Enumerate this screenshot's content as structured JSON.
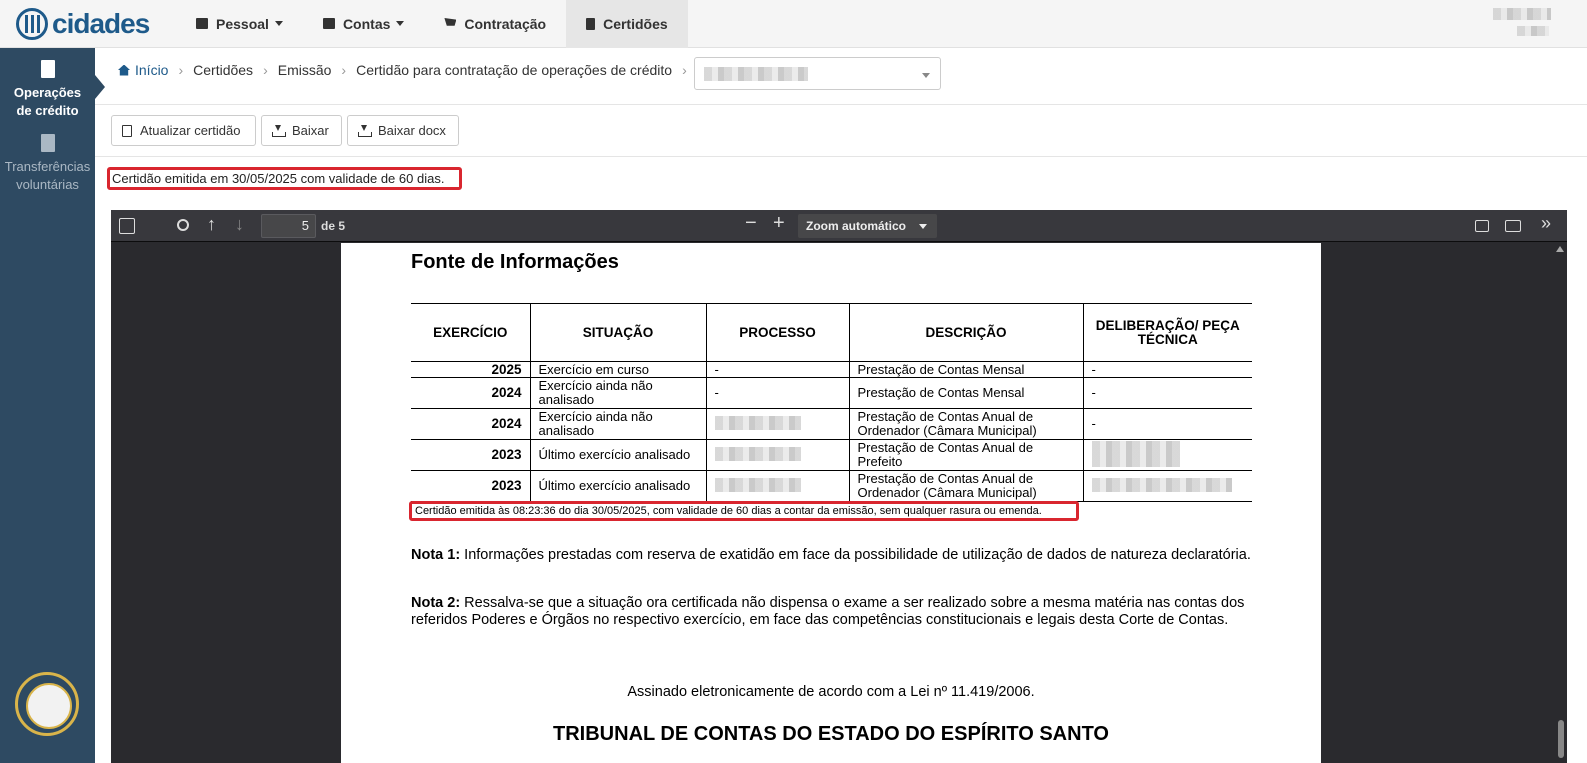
{
  "nav": {
    "logo": "cidades",
    "items": [
      {
        "label": "Pessoal"
      },
      {
        "label": "Contas"
      },
      {
        "label": "Contratação"
      },
      {
        "label": "Certidões"
      }
    ]
  },
  "sidebar": {
    "items": [
      {
        "label": "Operações de crédito"
      },
      {
        "label": "Transferências voluntárias"
      }
    ]
  },
  "breadcrumb": [
    "Início",
    "Certidões",
    "Emissão",
    "Certidão para contratação de operações de crédito"
  ],
  "toolbar": {
    "update": "Atualizar certidão",
    "download": "Baixar",
    "download_docx": "Baixar docx"
  },
  "issue_note": "Certidão emitida em 30/05/2025 com validade de 60 dias.",
  "pdf": {
    "page": "5",
    "of": "de 5",
    "zoom": "Zoom automático",
    "title": "Fonte de Informações",
    "headers": [
      "EXERCÍCIO",
      "SITUAÇÃO",
      "PROCESSO",
      "DESCRIÇÃO",
      "DELIBERAÇÃO/ PEÇA TÉCNICA"
    ],
    "rows": [
      {
        "ano": "2025",
        "situacao": "Exercício em curso",
        "processo": "-",
        "descricao": "Prestação de Contas Mensal",
        "deliberacao": "-"
      },
      {
        "ano": "2024",
        "situacao": "Exercício ainda não analisado",
        "processo": "-",
        "descricao": "Prestação de Contas Mensal",
        "deliberacao": "-"
      },
      {
        "ano": "2024",
        "situacao": "Exercício ainda não analisado",
        "processo": "",
        "descricao": "Prestação de Contas Anual de Ordenador (Câmara Municipal)",
        "deliberacao": "-"
      },
      {
        "ano": "2023",
        "situacao": "Último exercício analisado",
        "processo": "",
        "descricao": "Prestação de Contas Anual de Prefeito",
        "deliberacao": ""
      },
      {
        "ano": "2023",
        "situacao": "Último exercício analisado",
        "processo": "",
        "descricao": "Prestação de Contas Anual de Ordenador (Câmara Municipal)",
        "deliberacao": ""
      }
    ],
    "emit_note": "Certidão emitida às 08:23:36 do dia 30/05/2025, com validade de 60 dias a contar da emissão, sem qualquer rasura ou emenda.",
    "nota1_label": "Nota 1:",
    "nota1_text": " Informações prestadas com reserva de exatidão em face da possibilidade de utilização de dados de natureza declaratória.",
    "nota2_label": "Nota 2:",
    "nota2_text": " Ressalva-se que a situação ora certificada não dispensa o exame a ser realizado sobre a mesma matéria nas contas dos referidos Poderes e Órgãos no respectivo exercício, em face das competências constitucionais e legais desta Corte de Contas.",
    "assinado": "Assinado eletronicamente de acordo com a Lei nº 11.419/2006.",
    "tribunal": "TRIBUNAL DE CONTAS DO ESTADO DO ESPÍRITO SANTO"
  }
}
